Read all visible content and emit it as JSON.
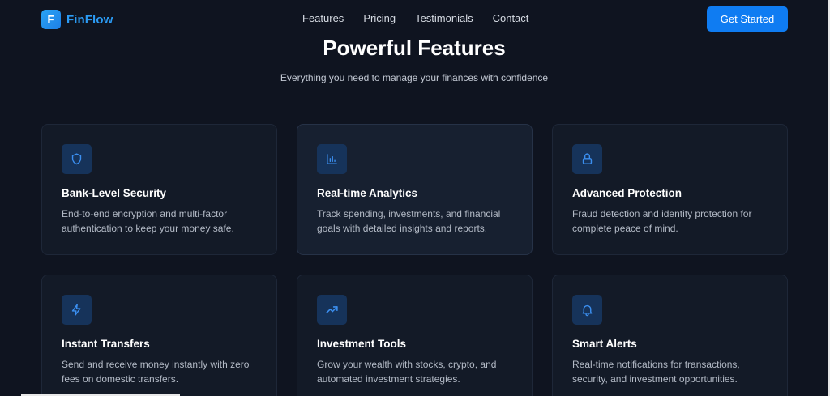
{
  "brand": {
    "logo_letter": "F",
    "name": "FinFlow"
  },
  "nav": {
    "links": [
      "Features",
      "Pricing",
      "Testimonials",
      "Contact"
    ],
    "cta_label": "Get Started"
  },
  "hero": {
    "title": "Powerful Features",
    "subtitle": "Everything you need to manage your finances with confidence"
  },
  "features": [
    {
      "icon": "shield-icon",
      "title": "Bank-Level Security",
      "description": "End-to-end encryption and multi-factor authentication to keep your money safe."
    },
    {
      "icon": "bar-chart-icon",
      "title": "Real-time Analytics",
      "description": "Track spending, investments, and financial goals with detailed insights and reports."
    },
    {
      "icon": "lock-icon",
      "title": "Advanced Protection",
      "description": "Fraud detection and identity protection for complete peace of mind."
    },
    {
      "icon": "lightning-icon",
      "title": "Instant Transfers",
      "description": "Send and receive money instantly with zero fees on domestic transfers."
    },
    {
      "icon": "trending-up-icon",
      "title": "Investment Tools",
      "description": "Grow your wealth with stocks, crypto, and automated investment strategies."
    },
    {
      "icon": "bell-icon",
      "title": "Smart Alerts",
      "description": "Real-time notifications for transactions, security, and investment opportunities."
    }
  ],
  "colors": {
    "background": "#0f1420",
    "card": "#131a27",
    "accent": "#0f7cf2",
    "icon_bg": "#16335a",
    "icon_stroke": "#3b8ff0"
  }
}
